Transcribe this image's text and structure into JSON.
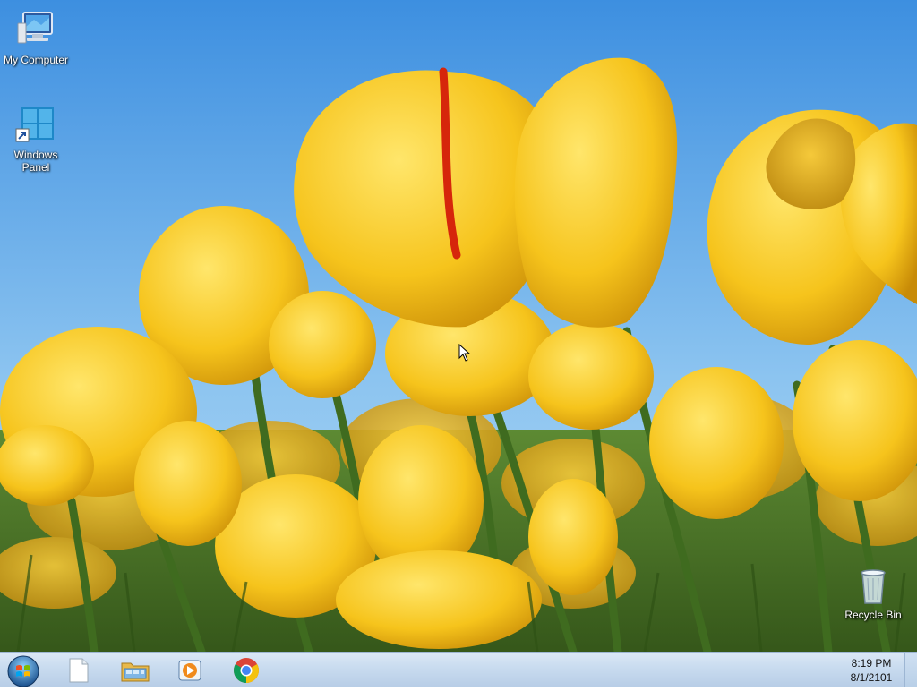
{
  "desktop": {
    "icons": [
      {
        "label": "My Computer",
        "icon": "my-computer-icon"
      },
      {
        "label": "Windows Panel",
        "icon": "windows-panel-icon"
      },
      {
        "label": "Recycle Bin",
        "icon": "recycle-bin-icon"
      }
    ]
  },
  "taskbar": {
    "pinned": [
      {
        "icon": "blank-document-icon"
      },
      {
        "icon": "file-explorer-icon"
      },
      {
        "icon": "media-player-icon"
      },
      {
        "icon": "chrome-icon"
      }
    ],
    "clock": {
      "time": "8:19 PM",
      "date": "8/1/2101"
    }
  },
  "colors": {
    "sky": "#6fb0ea",
    "tulip": "#f5c518",
    "stem": "#4f7a2a",
    "taskbar": "#c8dbef"
  }
}
